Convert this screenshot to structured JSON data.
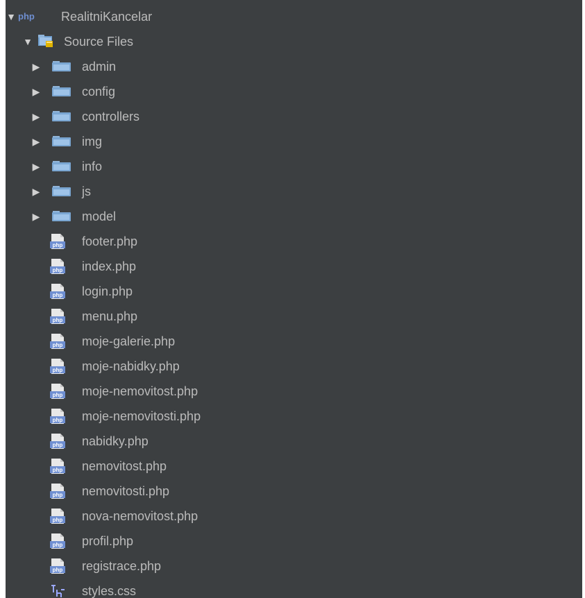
{
  "project": {
    "name": "RealitniKancelar",
    "badge": "php",
    "icon": "php-project-icon",
    "expanded": true
  },
  "source_files": {
    "label": "Source Files",
    "icon": "source-folder-icon",
    "expanded": true
  },
  "folders": [
    {
      "name": "admin",
      "expanded": false,
      "icon": "folder-icon"
    },
    {
      "name": "config",
      "expanded": false,
      "icon": "folder-icon"
    },
    {
      "name": "controllers",
      "expanded": false,
      "icon": "folder-icon"
    },
    {
      "name": "img",
      "expanded": false,
      "icon": "folder-icon"
    },
    {
      "name": "info",
      "expanded": false,
      "icon": "folder-icon"
    },
    {
      "name": "js",
      "expanded": false,
      "icon": "folder-icon"
    },
    {
      "name": "model",
      "expanded": false,
      "icon": "folder-icon"
    }
  ],
  "files": [
    {
      "name": "footer.php",
      "type": "php",
      "icon": "php-file-icon"
    },
    {
      "name": "index.php",
      "type": "php",
      "icon": "php-file-icon"
    },
    {
      "name": "login.php",
      "type": "php",
      "icon": "php-file-icon"
    },
    {
      "name": "menu.php",
      "type": "php",
      "icon": "php-file-icon"
    },
    {
      "name": "moje-galerie.php",
      "type": "php",
      "icon": "php-file-icon"
    },
    {
      "name": "moje-nabidky.php",
      "type": "php",
      "icon": "php-file-icon"
    },
    {
      "name": "moje-nemovitost.php",
      "type": "php",
      "icon": "php-file-icon"
    },
    {
      "name": "moje-nemovitosti.php",
      "type": "php",
      "icon": "php-file-icon"
    },
    {
      "name": "nabidky.php",
      "type": "php",
      "icon": "php-file-icon"
    },
    {
      "name": "nemovitost.php",
      "type": "php",
      "icon": "php-file-icon"
    },
    {
      "name": "nemovitosti.php",
      "type": "php",
      "icon": "php-file-icon"
    },
    {
      "name": "nova-nemovitost.php",
      "type": "php",
      "icon": "php-file-icon"
    },
    {
      "name": "profil.php",
      "type": "php",
      "icon": "php-file-icon"
    },
    {
      "name": "registrace.php",
      "type": "php",
      "icon": "php-file-icon"
    },
    {
      "name": "styles.css",
      "type": "css",
      "icon": "css-file-icon"
    }
  ],
  "colors": {
    "panel_bg": "#3c3f41",
    "text": "#bbbbbb",
    "folder": "#8fb4d9",
    "php_badge": "#6f8fd1",
    "css_icon": "#9aa7ff"
  }
}
